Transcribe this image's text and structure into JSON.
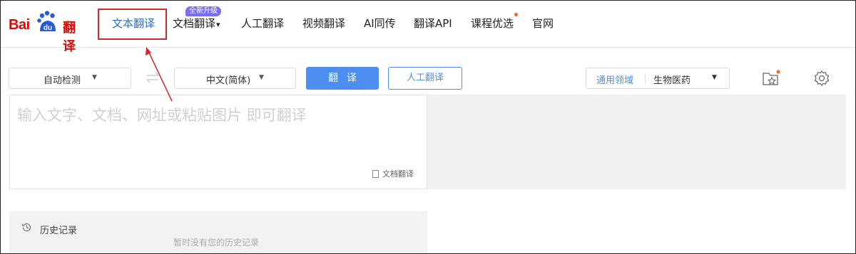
{
  "logo": {
    "bai": "Bai",
    "du": "du",
    "fanyi": "翻译"
  },
  "nav": [
    {
      "label": "文本翻译",
      "active": true
    },
    {
      "label": "文档翻译"
    },
    {
      "label": "人工翻译"
    },
    {
      "label": "视频翻译"
    },
    {
      "label": "AI同传"
    },
    {
      "label": "翻译API"
    },
    {
      "label": "课程优选",
      "dot": true
    },
    {
      "label": "官网"
    }
  ],
  "nav_caret": "▾",
  "badge": "全新升级",
  "toolbar": {
    "source_lang": "自动检测",
    "target_lang": "中文(简体)",
    "translate_label": "翻译",
    "human_label": "人工翻译",
    "domain_key": "通用领域",
    "domain_value": "生物医药"
  },
  "input": {
    "placeholder": "输入文字、文档、网址或粘贴图片 即可翻译",
    "doc_link": "文档翻译"
  },
  "history": {
    "title": "历史记录",
    "empty": "暂时没有您的历史记录"
  },
  "colors": {
    "brand_red": "#e10602",
    "accent_blue": "#4c8ff0",
    "badge_purple": "#7b6cf6",
    "annotation_red": "#d9262c"
  }
}
